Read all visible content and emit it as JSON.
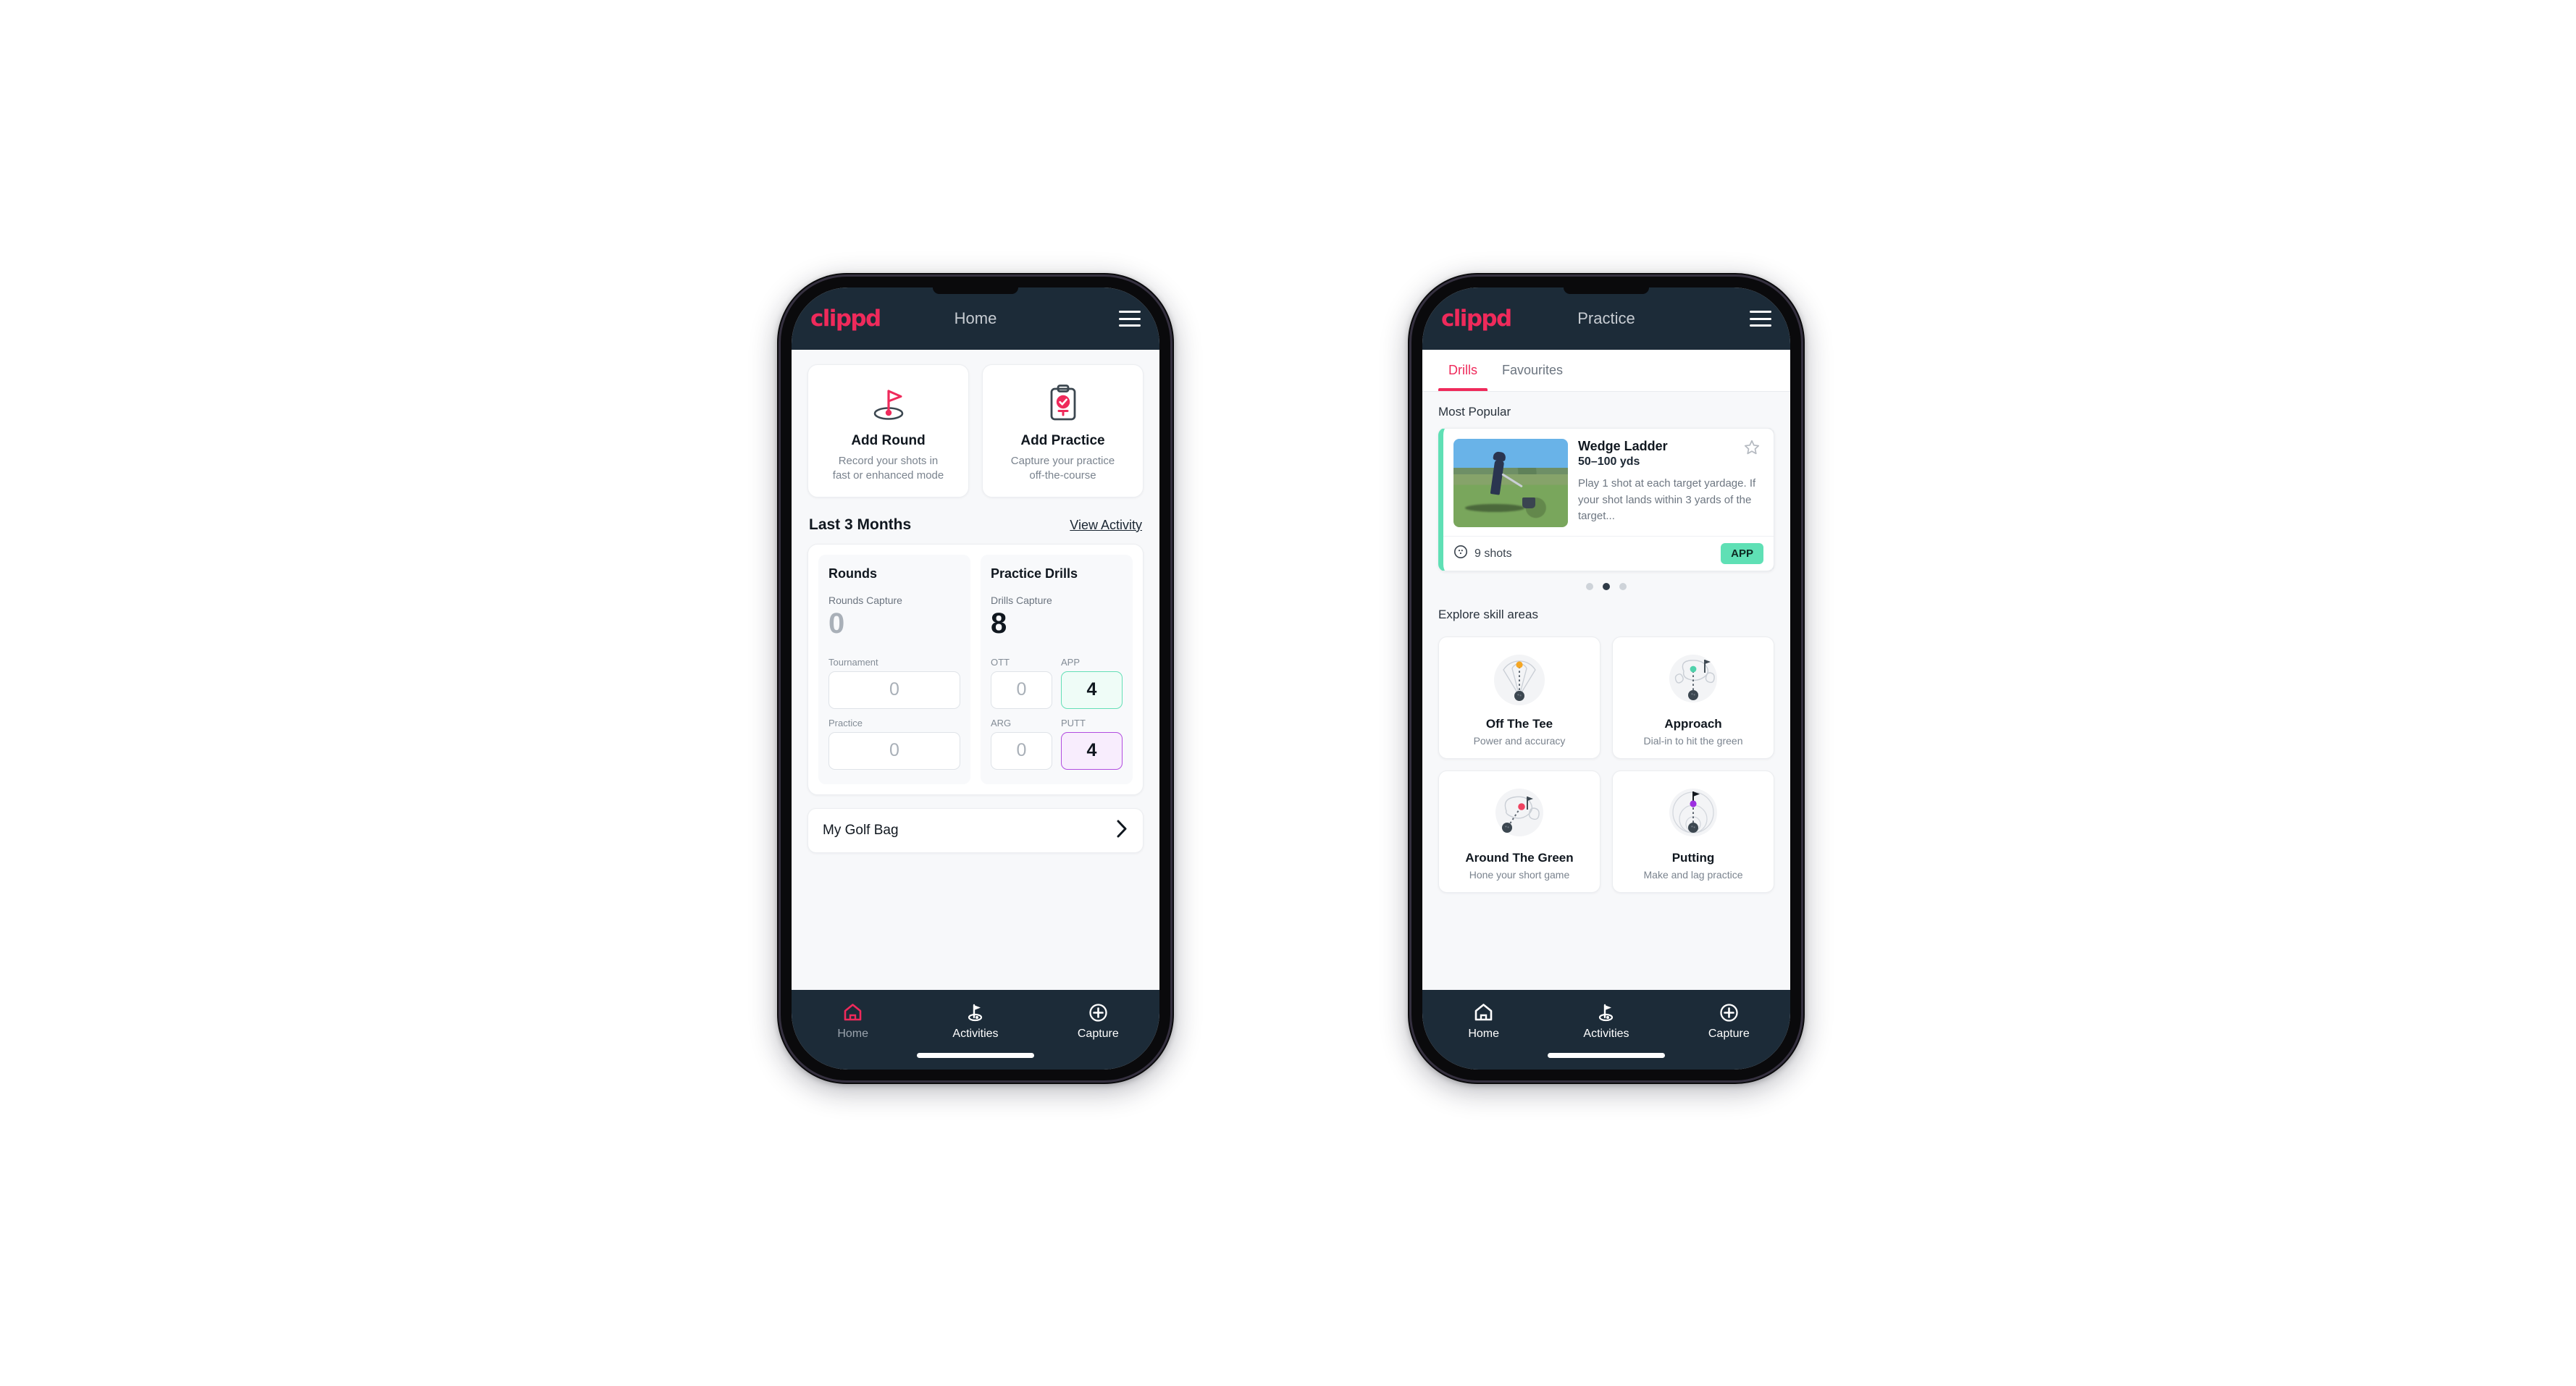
{
  "brand": {
    "logo_text": "clippd",
    "accent_pink": "#ef2a5b",
    "dark": "#1c2b38",
    "green": "#5fe0b5",
    "purple": "#9333ea"
  },
  "phone_home": {
    "appbar": {
      "title": "Home",
      "logo": "clippd",
      "menu_icon": "hamburger-icon"
    },
    "actions": [
      {
        "icon": "golf-flag-icon",
        "title": "Add Round",
        "subtitle_line1": "Record your shots in",
        "subtitle_line2": "fast or enhanced mode"
      },
      {
        "icon": "clipboard-check-icon",
        "title": "Add Practice",
        "subtitle_line1": "Capture your practice",
        "subtitle_line2": "off-the-course"
      }
    ],
    "section": {
      "title": "Last 3 Months",
      "link": "View Activity"
    },
    "rounds": {
      "heading": "Rounds",
      "capture_label": "Rounds Capture",
      "capture_value": "0",
      "fields": [
        {
          "label": "Tournament",
          "value": "0",
          "accent": "none"
        },
        {
          "label": "Practice",
          "value": "0",
          "accent": "none"
        }
      ]
    },
    "drills": {
      "heading": "Practice Drills",
      "capture_label": "Drills Capture",
      "capture_value": "8",
      "fields": [
        {
          "label": "OTT",
          "value": "0",
          "accent": "none"
        },
        {
          "label": "APP",
          "value": "4",
          "accent": "green"
        },
        {
          "label": "ARG",
          "value": "0",
          "accent": "none"
        },
        {
          "label": "PUTT",
          "value": "4",
          "accent": "purple"
        }
      ]
    },
    "golf_bag": {
      "label": "My Golf Bag",
      "chevron": "chevron-right-icon"
    },
    "nav": [
      {
        "label": "Home",
        "icon": "home-icon",
        "active": true
      },
      {
        "label": "Activities",
        "icon": "golf-flag-icon",
        "active": false
      },
      {
        "label": "Capture",
        "icon": "plus-circle-icon",
        "active": false
      }
    ]
  },
  "phone_practice": {
    "appbar": {
      "title": "Practice",
      "logo": "clippd",
      "menu_icon": "hamburger-icon"
    },
    "tabs": [
      {
        "label": "Drills",
        "active": true
      },
      {
        "label": "Favourites",
        "active": false
      }
    ],
    "most_popular_label": "Most Popular",
    "drill": {
      "title": "Wedge Ladder",
      "yardage": "50–100 yds",
      "description": "Play 1 shot at each target yardage. If your shot lands within 3 yards of the target...",
      "shots": "9 shots",
      "badge": "APP",
      "star_icon": "star-outline-icon",
      "shots_icon": "golf-ball-icon",
      "accent_left": "#5fe0b5",
      "accent_peek": "#9333ea"
    },
    "carousel_dots": {
      "count": 3,
      "active_index": 1
    },
    "skill_section_label": "Explore skill areas",
    "skills": [
      {
        "name": "Off The Tee",
        "subtitle": "Power and accuracy",
        "icon": "tee-dispersion-icon",
        "dot_color": "#f5a623"
      },
      {
        "name": "Approach",
        "subtitle": "Dial-in to hit the green",
        "icon": "green-approach-icon",
        "dot_color": "#4fd1ab"
      },
      {
        "name": "Around The Green",
        "subtitle": "Hone your short game",
        "icon": "chip-green-icon",
        "dot_color": "#ef4361"
      },
      {
        "name": "Putting",
        "subtitle": "Make and lag practice",
        "icon": "putting-rings-icon",
        "dot_color": "#9d2fe0"
      }
    ],
    "nav": [
      {
        "label": "Home",
        "icon": "home-icon",
        "active": false
      },
      {
        "label": "Activities",
        "icon": "golf-flag-icon",
        "active": true
      },
      {
        "label": "Capture",
        "icon": "plus-circle-icon",
        "active": false
      }
    ]
  }
}
